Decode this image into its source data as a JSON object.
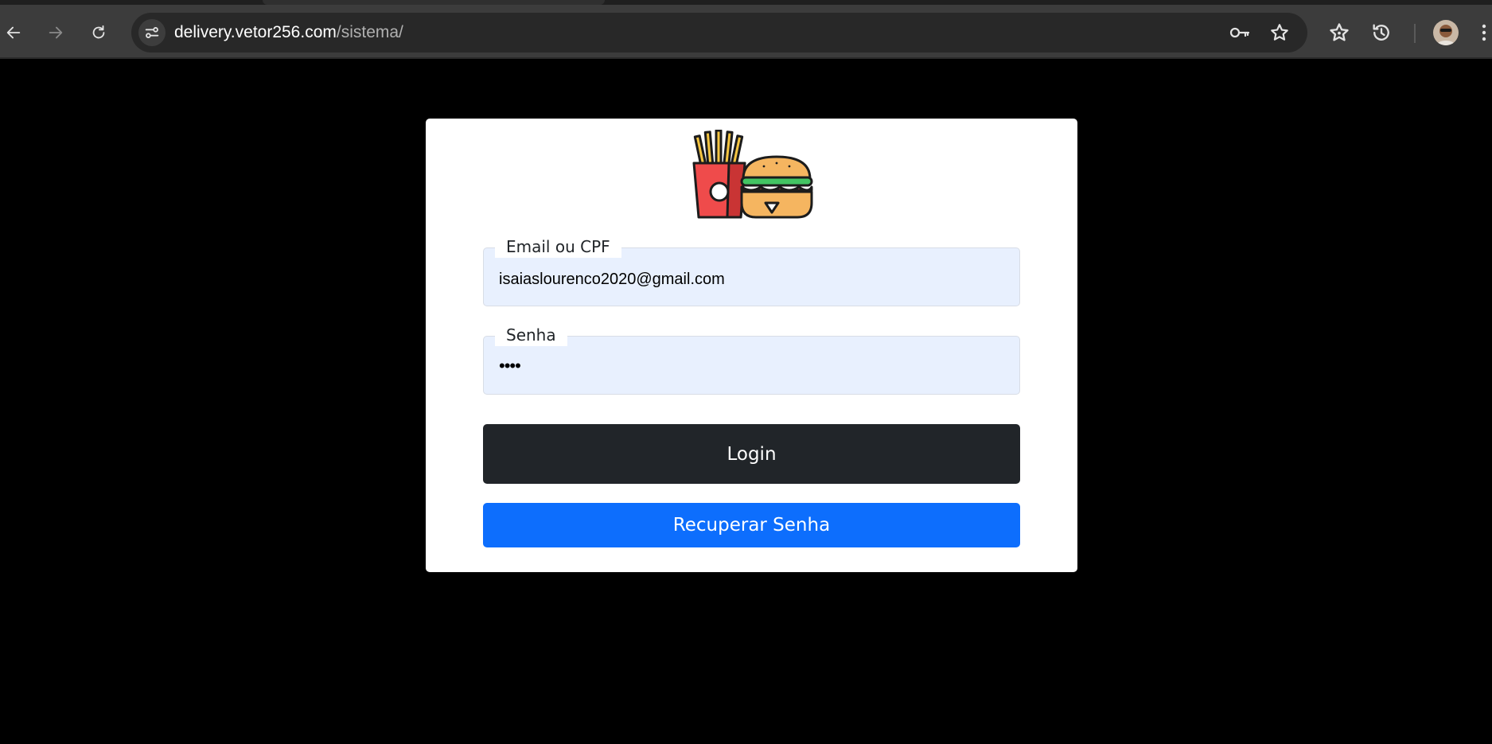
{
  "browser": {
    "url_host": "delivery.vetor256.com",
    "url_path": "/sistema/",
    "icons": {
      "back": "arrow-left-icon",
      "forward": "arrow-right-icon",
      "reload": "reload-icon",
      "site_info": "tune-icon",
      "password_key": "key-icon",
      "bookmark": "star-icon",
      "bookmarks_list": "star-list-icon",
      "history": "history-icon",
      "menu": "kebab-menu-icon"
    },
    "colors": {
      "toolbar": "#3c3c3c",
      "omnibox": "#282828"
    }
  },
  "login": {
    "email_label": "Email ou CPF",
    "email_value": "isaiaslourenco2020@gmail.com",
    "password_label": "Senha",
    "password_value": "••••",
    "login_button": "Login",
    "recover_button": "Recuperar Senha",
    "logo": "fries-burger-logo"
  },
  "colors": {
    "page_background": "#000000",
    "card": "#ffffff",
    "input_autofill": "#e8f0fe",
    "login_button": "#212529",
    "recover_button": "#0d6efd"
  }
}
